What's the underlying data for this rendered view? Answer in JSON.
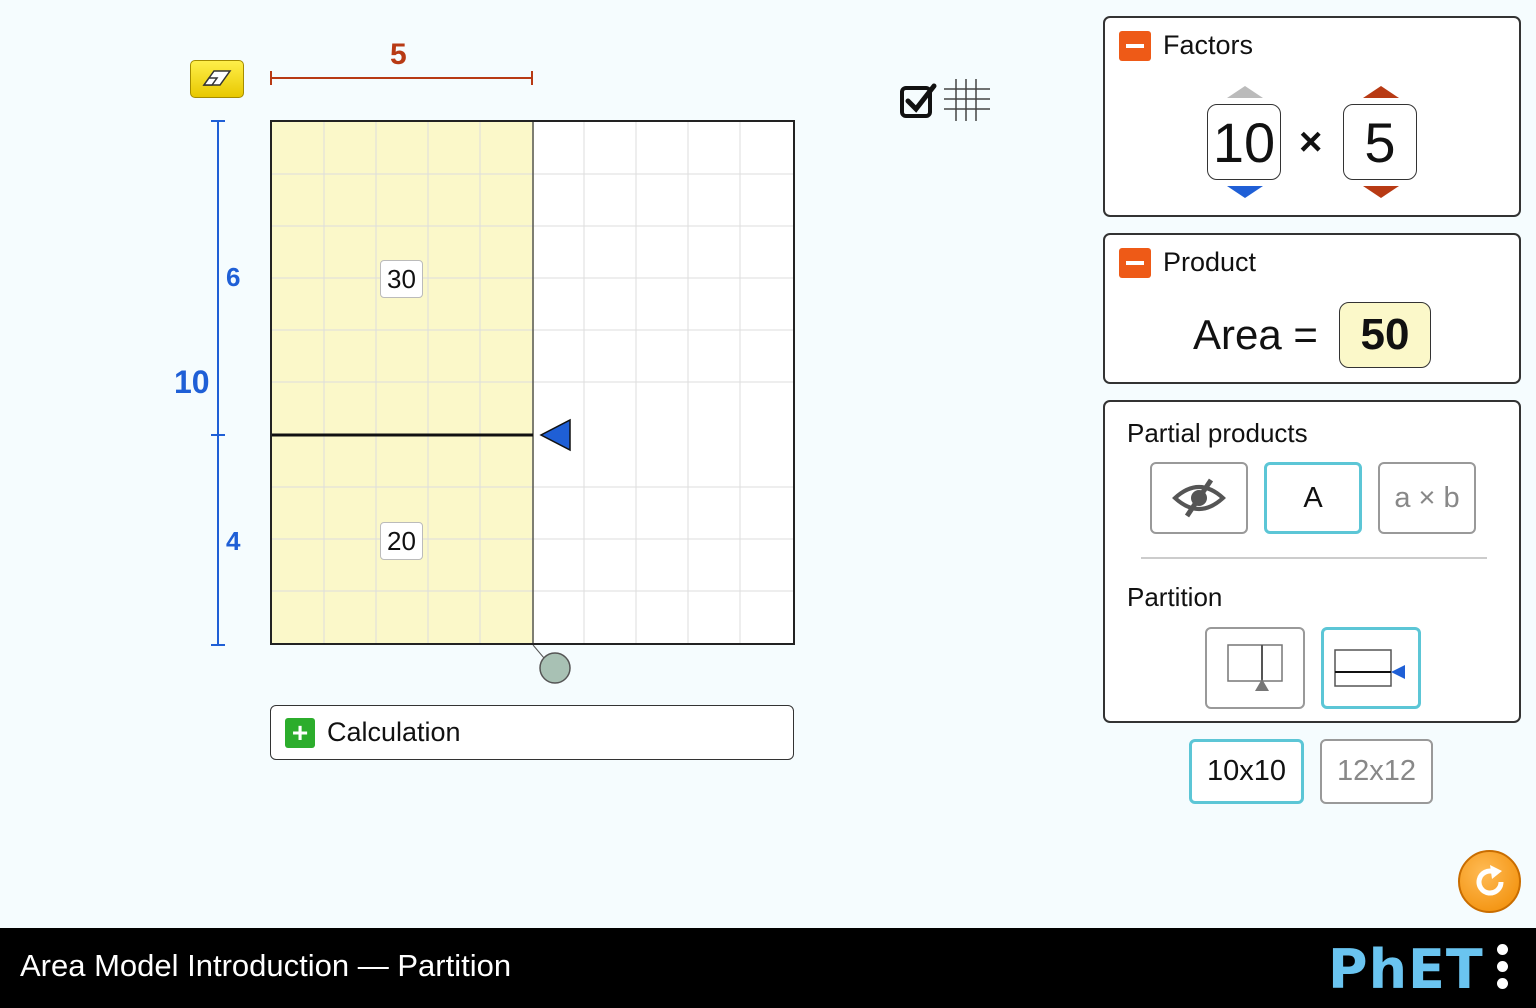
{
  "model": {
    "width_label": "5",
    "height_total_label": "10",
    "height_top_label": "6",
    "height_bottom_label": "4",
    "partial_top": "30",
    "partial_bottom": "20"
  },
  "calculation": {
    "label": "Calculation"
  },
  "factors": {
    "title": "Factors",
    "first": "10",
    "times": "×",
    "second": "5"
  },
  "product": {
    "title": "Product",
    "area_label": "Area =",
    "value": "50"
  },
  "partial_products": {
    "title": "Partial products",
    "options": [
      "A",
      "a × b"
    ]
  },
  "partition": {
    "title": "Partition"
  },
  "grid_size": {
    "options": [
      "10x10",
      "12x12"
    ],
    "selected": "10x10"
  },
  "nav": {
    "title": "Area Model Introduction — Partition",
    "logo": "PhET"
  },
  "colors": {
    "width_color": "#b83a14",
    "height_color": "#1f5fd6",
    "shaded": "#fbf8c9",
    "accent": "#5cc6d6"
  }
}
